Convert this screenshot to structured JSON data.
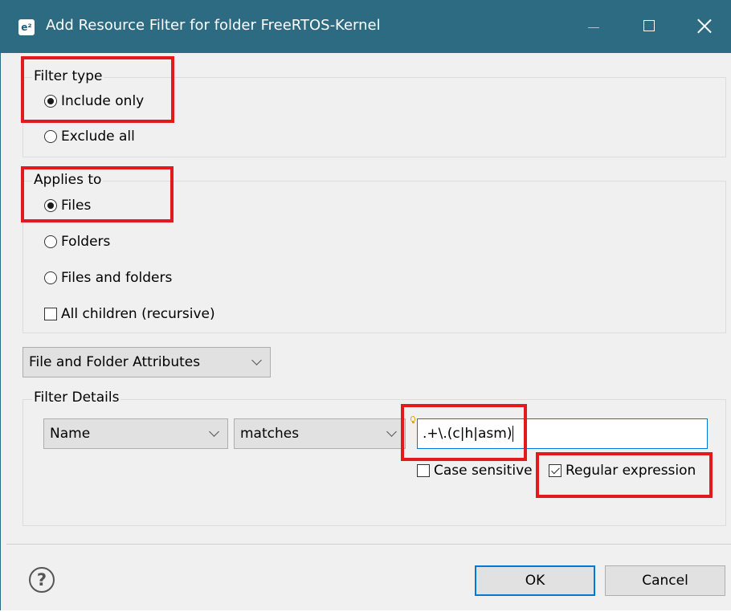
{
  "window": {
    "title": "Add Resource Filter for folder FreeRTOS-Kernel",
    "app_icon": "e²",
    "controls": [
      "minimize-icon",
      "maximize-icon",
      "close-icon"
    ]
  },
  "filter_type": {
    "legend": "Filter type",
    "options": [
      {
        "label": "Include only",
        "selected": true
      },
      {
        "label": "Exclude all",
        "selected": false
      }
    ]
  },
  "applies_to": {
    "legend": "Applies to",
    "options": [
      {
        "label": "Files",
        "selected": true
      },
      {
        "label": "Folders",
        "selected": false
      },
      {
        "label": "Files and folders",
        "selected": false
      }
    ],
    "recursive": {
      "label": "All children (recursive)",
      "checked": false
    }
  },
  "attributes_combo": {
    "value": "File and Folder Attributes"
  },
  "filter_details": {
    "legend": "Filter Details",
    "attribute_combo": {
      "value": "Name"
    },
    "operator_combo": {
      "value": "matches"
    },
    "pattern_value": ".+\\.(c|h|asm)",
    "case_sensitive": {
      "label": "Case sensitive",
      "checked": false
    },
    "regular_expression": {
      "label": "Regular expression",
      "checked": true
    }
  },
  "buttons": {
    "ok": "OK",
    "cancel": "Cancel"
  },
  "colors": {
    "titlebar": "#2c6b82",
    "highlight": "#e2191d",
    "focus": "#0078d7"
  }
}
